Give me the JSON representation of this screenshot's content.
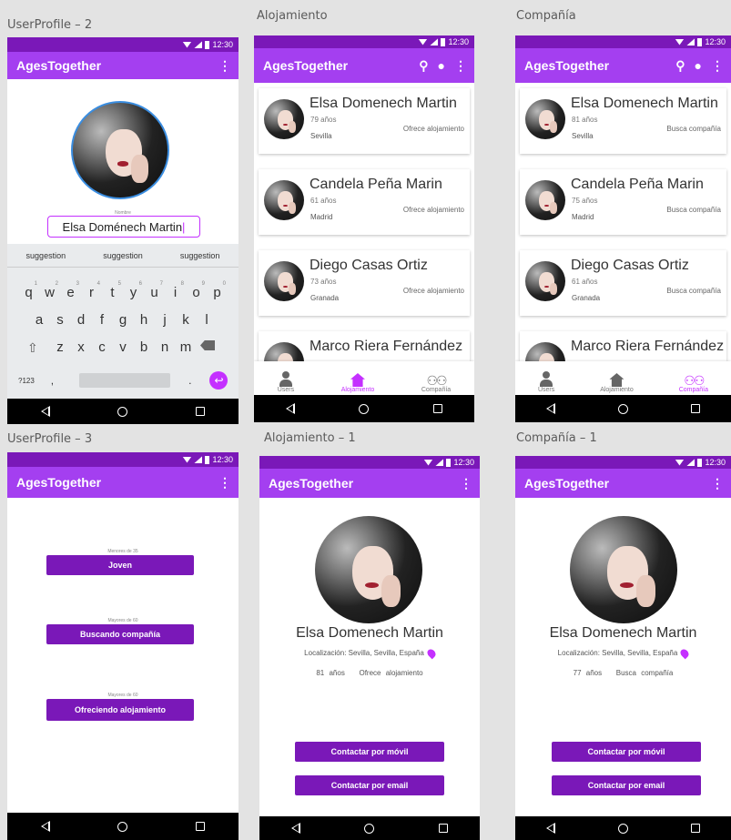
{
  "app_name": "AgesTogether",
  "status_time": "12:30",
  "frames": {
    "userprofile2": "UserProfile – 2",
    "alojamiento": "Alojamiento",
    "compania": "Compañía",
    "userprofile3": "UserProfile – 3",
    "alojamiento1": "Alojamiento – 1",
    "compania1": "Compañía – 1"
  },
  "profile2": {
    "field_label": "Nombre",
    "field_value": "Elsa Doménech Martin",
    "suggestions": [
      "suggestion",
      "suggestion",
      "suggestion"
    ],
    "row1": [
      "q",
      "w",
      "e",
      "r",
      "t",
      "y",
      "u",
      "i",
      "o",
      "p"
    ],
    "row1_nums": [
      "1",
      "2",
      "3",
      "4",
      "5",
      "6",
      "7",
      "8",
      "9",
      "0"
    ],
    "row2": [
      "a",
      "s",
      "d",
      "f",
      "g",
      "h",
      "j",
      "k",
      "l"
    ],
    "row3": [
      "z",
      "x",
      "c",
      "v",
      "b",
      "n",
      "m"
    ],
    "sym_key": "?123",
    "comma_key": ",",
    "period_key": "."
  },
  "listing_aloj": [
    {
      "name": "Elsa Domenech Martin",
      "age": "79 años",
      "city": "Sevilla",
      "type": "Ofrece alojamiento"
    },
    {
      "name": "Candela Peña Marin",
      "age": "61 años",
      "city": "Madrid",
      "type": "Ofrece alojamiento"
    },
    {
      "name": "Diego Casas Ortiz",
      "age": "73 años",
      "city": "Granada",
      "type": "Ofrece alojamiento"
    },
    {
      "name": "Marco Riera Fernández"
    }
  ],
  "listing_comp": [
    {
      "name": "Elsa Domenech Martin",
      "age": "81 años",
      "city": "Sevilla",
      "type": "Busca compañía"
    },
    {
      "name": "Candela Peña Marin",
      "age": "75 años",
      "city": "Madrid",
      "type": "Busca compañía"
    },
    {
      "name": "Diego Casas Ortiz",
      "age": "61 años",
      "city": "Granada",
      "type": "Busca compañía"
    },
    {
      "name": "Marco Riera Fernández"
    }
  ],
  "bottom_nav": {
    "users": "Users",
    "alojamiento": "Alojamiento",
    "compania": "Compañía"
  },
  "profile3": {
    "options": [
      {
        "caption": "Menores de 35",
        "label": "Joven"
      },
      {
        "caption": "Mayores de 60",
        "label": "Buscando compañía"
      },
      {
        "caption": "Mayores de 60",
        "label": "Ofreciendo alojamiento"
      }
    ]
  },
  "detail_aloj": {
    "name": "Elsa Domenech Martin",
    "location": "Localización: Sevilla, Sevilla, España",
    "age": "81 años",
    "type": "Ofrece alojamiento",
    "btn_phone": "Contactar por móvil",
    "btn_email": "Contactar por email"
  },
  "detail_comp": {
    "name": "Elsa Domenech Martin",
    "location": "Localización: Sevilla, Sevilla, España",
    "age": "77 años",
    "type": "Busca compañía",
    "btn_phone": "Contactar por móvil",
    "btn_email": "Contactar por email"
  },
  "colors": {
    "appbar": "#a43ff0",
    "status": "#7a18b8",
    "accent": "#c430ff",
    "button": "#7a18b8"
  },
  "icons": [
    "search-icon",
    "person-icon",
    "kebab-menu-icon",
    "user-icon",
    "house-icon",
    "people-icon",
    "location-pin-icon",
    "back-icon",
    "home-icon",
    "recent-apps-icon"
  ]
}
